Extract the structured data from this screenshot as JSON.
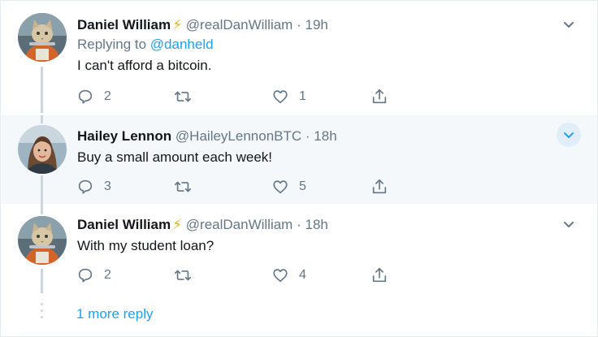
{
  "tweets": [
    {
      "name": "Daniel William",
      "has_bolt": true,
      "handle": "@realDanWilliam",
      "sep": "·",
      "time": "19h",
      "reply_label": "Replying to",
      "reply_mention": "@danheld",
      "text": "I can't afford a bitcoin.",
      "replies": "2",
      "retweets": "",
      "likes": "1"
    },
    {
      "name": "Hailey Lennon",
      "has_bolt": false,
      "handle": "@HaileyLennonBTC",
      "sep": "·",
      "time": "18h",
      "text": "Buy a small amount each week!",
      "replies": "3",
      "retweets": "",
      "likes": "5"
    },
    {
      "name": "Daniel William",
      "has_bolt": true,
      "handle": "@realDanWilliam",
      "sep": "·",
      "time": "18h",
      "text": "With my student loan?",
      "replies": "2",
      "retweets": "",
      "likes": "4"
    }
  ],
  "bolt_glyph": "⚡",
  "more_replies": "1 more reply",
  "colors": {
    "accent": "#1da1f2",
    "muted": "#657786",
    "line": "#ccd6dd",
    "highlight_bg": "#f5f8fa"
  },
  "icons": [
    "reply-icon",
    "retweet-icon",
    "like-icon",
    "share-icon",
    "chevron-down-icon"
  ]
}
